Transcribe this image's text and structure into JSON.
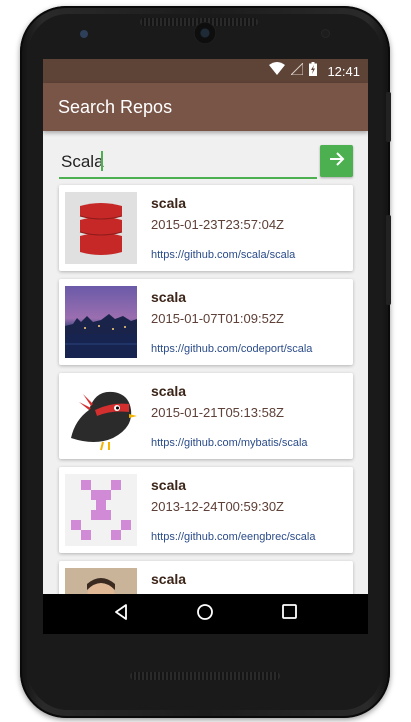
{
  "status_bar": {
    "time": "12:41",
    "icons": [
      "wifi-icon",
      "signal-icon",
      "battery-charging-icon"
    ]
  },
  "app_bar": {
    "title": "Search Repos"
  },
  "search": {
    "value": "Scala",
    "button_icon": "arrow-right-icon"
  },
  "repos": [
    {
      "name": "scala",
      "date": "2015-01-23T23:57:04Z",
      "url": "https://github.com/scala/scala"
    },
    {
      "name": "scala",
      "date": "2015-01-07T01:09:52Z",
      "url": "https://github.com/codeport/scala"
    },
    {
      "name": "scala",
      "date": "2015-01-21T05:13:58Z",
      "url": "https://github.com/mybatis/scala"
    },
    {
      "name": "scala",
      "date": "2013-12-24T00:59:30Z",
      "url": "https://github.com/eengbrec/scala"
    },
    {
      "name": "scala"
    }
  ],
  "nav_bar": {
    "buttons": [
      "back-icon",
      "home-icon",
      "recents-icon"
    ]
  },
  "colors": {
    "status_bar": "#5e4337",
    "app_bar": "#795548",
    "accent": "#4caf50"
  }
}
